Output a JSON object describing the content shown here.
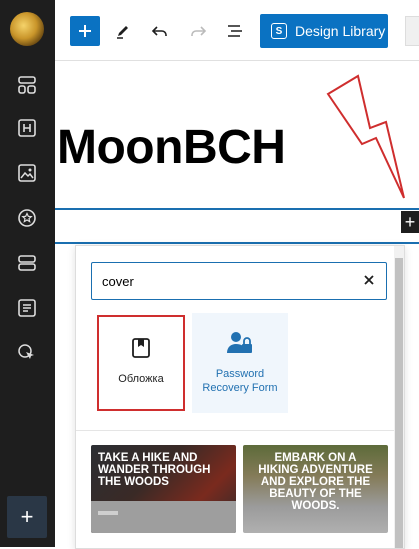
{
  "toolbar": {
    "design_library_label": "Design Library",
    "design_library_badge": "S",
    "colors": {
      "primary": "#0a72c2"
    }
  },
  "page": {
    "title": "MoonBCH"
  },
  "sidebar": {
    "icons": [
      "layout-icon",
      "heading-icon",
      "image-icon",
      "star-icon",
      "sections-icon",
      "form-icon",
      "cursor-click-icon"
    ],
    "add_label": "+"
  },
  "inserter": {
    "plus_label": "+",
    "search_value": "cover",
    "blocks": [
      {
        "label": "Обложка",
        "icon": "cover-icon",
        "highlighted": true
      },
      {
        "label": "Password Recovery Form",
        "icon": "user-lock-icon",
        "highlighted": false
      }
    ],
    "patterns": [
      {
        "text": "TAKE A HIKE AND WANDER THROUGH THE WOODS"
      },
      {
        "text": "EMBARK ON A HIKING ADVENTURE AND EXPLORE THE BEAUTY OF THE WOODS."
      }
    ]
  },
  "annotation": {
    "arrow_color": "#cf2e2e"
  }
}
